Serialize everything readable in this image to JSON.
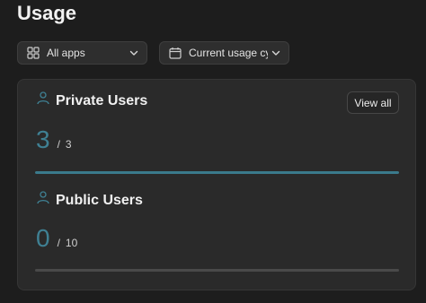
{
  "page": {
    "title": "Usage"
  },
  "filters": {
    "apps": {
      "label": "All apps",
      "icon": "grid-icon"
    },
    "cycle": {
      "label": "Current usage cyc",
      "icon": "calendar-icon"
    }
  },
  "sections": [
    {
      "title": "Private Users",
      "icon": "user-icon",
      "used": "3",
      "separator": "/",
      "total": "3",
      "progress": 1.0,
      "action_label": "View all"
    },
    {
      "title": "Public Users",
      "icon": "user-icon",
      "used": "0",
      "separator": "/",
      "total": "10",
      "progress": 0.0
    }
  ],
  "colors": {
    "accent": "#3f8093",
    "bar_fill": "#3a7a8c",
    "bar_track": "#4a4a4a"
  }
}
